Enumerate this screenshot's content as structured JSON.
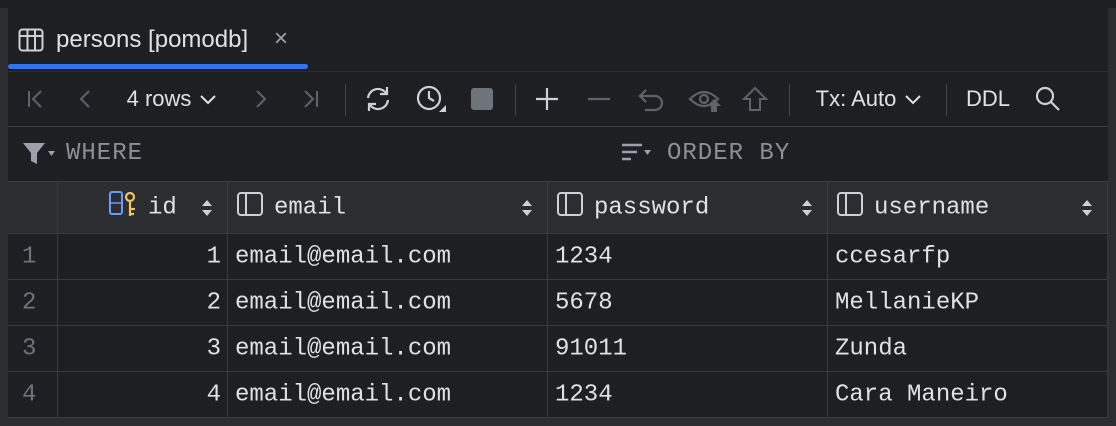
{
  "tab": {
    "title": "persons [pomodb]",
    "close_glyph": "×",
    "icon": "table-icon"
  },
  "toolbar": {
    "rows_label": "4 rows",
    "tx_label": "Tx: Auto",
    "ddl_label": "DDL",
    "accent": "#3574f0"
  },
  "filter": {
    "where_label": "WHERE",
    "order_label": "ORDER BY"
  },
  "table": {
    "columns": [
      {
        "label": "id",
        "icon": "primary-key-icon"
      },
      {
        "label": "email",
        "icon": "column-icon"
      },
      {
        "label": "password",
        "icon": "column-icon"
      },
      {
        "label": "username",
        "icon": "column-icon"
      }
    ],
    "rows": [
      {
        "num": "1",
        "id": "1",
        "email": "email@email.com",
        "password": "1234",
        "username": "ccesarfp"
      },
      {
        "num": "2",
        "id": "2",
        "email": "email@email.com",
        "password": "5678",
        "username": "MellanieKP"
      },
      {
        "num": "3",
        "id": "3",
        "email": "email@email.com",
        "password": "91011",
        "username": "Zunda"
      },
      {
        "num": "4",
        "id": "4",
        "email": "email@email.com",
        "password": "1234",
        "username": "Cara Maneiro"
      }
    ]
  }
}
